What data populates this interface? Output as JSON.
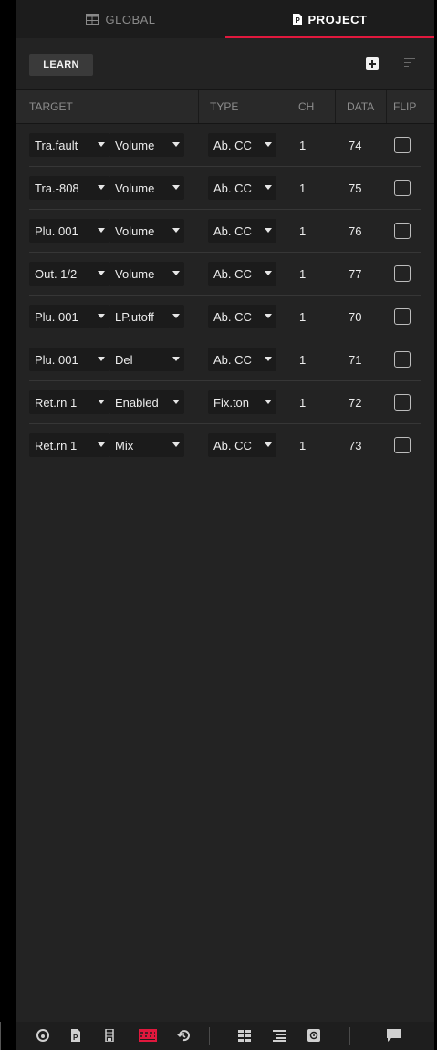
{
  "tabs": {
    "global_label": "GLOBAL",
    "project_label": "PROJECT"
  },
  "toolbar": {
    "learn_label": "LEARN",
    "add_icon": "plus-square-icon",
    "sort_icon": "sort-lines-icon"
  },
  "columns": {
    "target": "TARGET",
    "type": "TYPE",
    "ch": "CH",
    "data": "DATA",
    "flip": "FLIP"
  },
  "rows": [
    {
      "target": "Tra.fault",
      "param": "Volume",
      "type": "Ab. CC",
      "ch": "1",
      "data": "74",
      "flip": false
    },
    {
      "target": "Tra.-808",
      "param": "Volume",
      "type": "Ab. CC",
      "ch": "1",
      "data": "75",
      "flip": false
    },
    {
      "target": "Plu. 001",
      "param": "Volume",
      "type": "Ab. CC",
      "ch": "1",
      "data": "76",
      "flip": false
    },
    {
      "target": "Out. 1/2",
      "param": "Volume",
      "type": "Ab. CC",
      "ch": "1",
      "data": "77",
      "flip": false
    },
    {
      "target": "Plu. 001",
      "param": "LP.utoff",
      "type": "Ab. CC",
      "ch": "1",
      "data": "70",
      "flip": false
    },
    {
      "target": "Plu. 001",
      "param": "Del",
      "type": "Ab. CC",
      "ch": "1",
      "data": "71",
      "flip": false
    },
    {
      "target": "Ret.rn 1",
      "param": "Enabled",
      "type": "Fix.ton",
      "ch": "1",
      "data": "72",
      "flip": false
    },
    {
      "target": "Ret.rn 1",
      "param": "Mix",
      "type": "Ab. CC",
      "ch": "1",
      "data": "73",
      "flip": false
    }
  ],
  "colors": {
    "accent": "#e0183d",
    "panel_bg": "#232323",
    "dropdown_bg": "#1b1b1b"
  },
  "footer_icons": [
    "browser-icon",
    "project-icon",
    "mixer-strip-icon",
    "midi-learn-icon",
    "history-icon",
    "grid-view-icon",
    "list-view-icon",
    "plugin-icon",
    "chat-icon"
  ]
}
